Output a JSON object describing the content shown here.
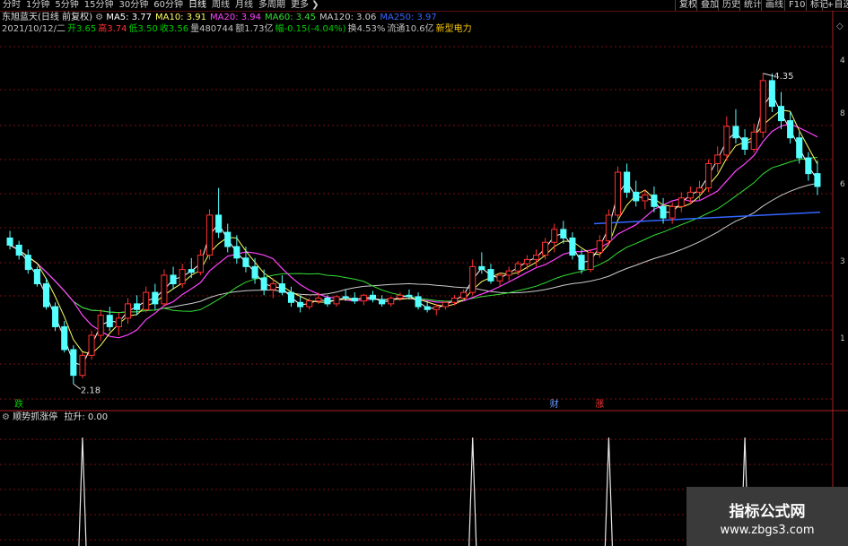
{
  "toolbar": {
    "period_tabs": [
      "分时",
      "1分钟",
      "5分钟",
      "15分钟",
      "30分钟",
      "60分钟",
      "日线",
      "周线",
      "月线",
      "多周期",
      "更多"
    ],
    "right_buttons": [
      "复权",
      "叠加",
      "历史",
      "统计",
      "画线",
      "F10",
      "标记",
      "+自选"
    ]
  },
  "header": {
    "stock_title": "东旭蓝天(日线 前复权)",
    "ma_items": [
      {
        "label": "MA5: 3.77",
        "color": "#ffffff"
      },
      {
        "label": "MA10: 3.91",
        "color": "#ffff66"
      },
      {
        "label": "MA20: 3.94",
        "color": "#ff44ff"
      },
      {
        "label": "MA60: 3.45",
        "color": "#33dd33"
      },
      {
        "label": "MA120: 3.06",
        "color": "#cccccc"
      },
      {
        "label": "MA250: 3.97",
        "color": "#3366ff"
      }
    ],
    "info_items": [
      {
        "label": "2021/10/12/二",
        "color": "#c0c0c0"
      },
      {
        "label": "开3.65",
        "color": "#00cc00"
      },
      {
        "label": "高3.74",
        "color": "#ff3333"
      },
      {
        "label": "低3.50",
        "color": "#00cc00"
      },
      {
        "label": "收3.56",
        "color": "#00cc00"
      },
      {
        "label": "量480744",
        "color": "#c0c0c0"
      },
      {
        "label": "额1.73亿",
        "color": "#c0c0c0"
      },
      {
        "label": "幅-0.15(-4.04%)",
        "color": "#00cc00"
      },
      {
        "label": "换4.53%",
        "color": "#c0c0c0"
      },
      {
        "label": "流通10.6亿",
        "color": "#c0c0c0"
      },
      {
        "label": "新型电力",
        "color": "#ffcc00"
      }
    ]
  },
  "annotations": {
    "high_label": "4.35",
    "low_label": "2.18",
    "bottom_marks": [
      {
        "text": "跌",
        "color": "#00cc00",
        "index": 1
      },
      {
        "text": "财",
        "color": "#6699ff",
        "index": 86
      },
      {
        "text": "涨",
        "color": "#ff3333",
        "index": 94
      }
    ],
    "right_axis_glyphs": [
      "4",
      "8",
      "6",
      "3",
      "1"
    ]
  },
  "indicator": {
    "title": "顺势抓涨停",
    "value_label": "拉升: 0.00",
    "spike_indices": [
      18,
      120,
      155,
      190
    ]
  },
  "watermark": {
    "line1": "指标公式网",
    "line2": "www.zbgs3.com"
  },
  "chart_data": {
    "type": "candlestick",
    "ylim": [
      2.0,
      4.6
    ],
    "colors": {
      "up": "#ff3232",
      "down": "#54ffff",
      "ma5": "#ffffff",
      "ma10": "#ffff66",
      "ma20": "#ff44ff",
      "ma60": "#33dd33",
      "ma120": "#cccccc",
      "ma250": "#3366ff"
    },
    "ohlc": [
      [
        3.2,
        3.25,
        3.12,
        3.15
      ],
      [
        3.15,
        3.18,
        3.05,
        3.08
      ],
      [
        3.08,
        3.12,
        2.95,
        2.98
      ],
      [
        2.98,
        3.0,
        2.86,
        2.88
      ],
      [
        2.88,
        2.92,
        2.7,
        2.72
      ],
      [
        2.72,
        2.75,
        2.55,
        2.58
      ],
      [
        2.58,
        2.62,
        2.4,
        2.42
      ],
      [
        2.42,
        2.45,
        2.18,
        2.24
      ],
      [
        2.24,
        2.4,
        2.22,
        2.38
      ],
      [
        2.38,
        2.55,
        2.35,
        2.52
      ],
      [
        2.52,
        2.7,
        2.48,
        2.66
      ],
      [
        2.66,
        2.72,
        2.55,
        2.58
      ],
      [
        2.58,
        2.68,
        2.52,
        2.64
      ],
      [
        2.64,
        2.78,
        2.6,
        2.74
      ],
      [
        2.74,
        2.8,
        2.66,
        2.7
      ],
      [
        2.7,
        2.86,
        2.68,
        2.82
      ],
      [
        2.82,
        2.88,
        2.7,
        2.74
      ],
      [
        2.74,
        2.98,
        2.72,
        2.94
      ],
      [
        2.94,
        3.0,
        2.84,
        2.88
      ],
      [
        2.88,
        3.02,
        2.85,
        2.98
      ],
      [
        2.98,
        3.06,
        2.92,
        2.96
      ],
      [
        2.96,
        3.12,
        2.94,
        3.08
      ],
      [
        3.08,
        3.4,
        3.05,
        3.36
      ],
      [
        3.36,
        3.55,
        3.2,
        3.24
      ],
      [
        3.24,
        3.3,
        3.1,
        3.14
      ],
      [
        3.14,
        3.22,
        3.02,
        3.06
      ],
      [
        3.06,
        3.14,
        2.96,
        3.0
      ],
      [
        3.0,
        3.06,
        2.88,
        2.92
      ],
      [
        2.92,
        2.98,
        2.8,
        2.84
      ],
      [
        2.84,
        2.92,
        2.78,
        2.88
      ],
      [
        2.88,
        2.94,
        2.8,
        2.82
      ],
      [
        2.82,
        2.86,
        2.72,
        2.75
      ],
      [
        2.75,
        2.8,
        2.68,
        2.72
      ],
      [
        2.72,
        2.78,
        2.7,
        2.76
      ],
      [
        2.76,
        2.82,
        2.74,
        2.78
      ],
      [
        2.78,
        2.8,
        2.72,
        2.74
      ],
      [
        2.74,
        2.8,
        2.72,
        2.79
      ],
      [
        2.79,
        2.84,
        2.76,
        2.78
      ],
      [
        2.78,
        2.82,
        2.74,
        2.76
      ],
      [
        2.76,
        2.81,
        2.73,
        2.8
      ],
      [
        2.8,
        2.83,
        2.75,
        2.77
      ],
      [
        2.77,
        2.8,
        2.72,
        2.74
      ],
      [
        2.74,
        2.79,
        2.72,
        2.78
      ],
      [
        2.78,
        2.82,
        2.76,
        2.8
      ],
      [
        2.8,
        2.84,
        2.77,
        2.79
      ],
      [
        2.79,
        2.82,
        2.7,
        2.72
      ],
      [
        2.72,
        2.76,
        2.68,
        2.7
      ],
      [
        2.7,
        2.74,
        2.66,
        2.72
      ],
      [
        2.72,
        2.76,
        2.7,
        2.75
      ],
      [
        2.75,
        2.8,
        2.73,
        2.78
      ],
      [
        2.78,
        2.84,
        2.76,
        2.82
      ],
      [
        2.82,
        3.05,
        2.8,
        3.0
      ],
      [
        3.0,
        3.1,
        2.95,
        2.98
      ],
      [
        2.98,
        3.02,
        2.88,
        2.9
      ],
      [
        2.9,
        2.96,
        2.86,
        2.94
      ],
      [
        2.94,
        3.0,
        2.9,
        2.97
      ],
      [
        2.97,
        3.04,
        2.94,
        3.02
      ],
      [
        3.02,
        3.08,
        2.98,
        3.05
      ],
      [
        3.05,
        3.12,
        3.0,
        3.08
      ],
      [
        3.08,
        3.2,
        3.05,
        3.17
      ],
      [
        3.17,
        3.3,
        3.1,
        3.26
      ],
      [
        3.26,
        3.32,
        3.16,
        3.2
      ],
      [
        3.2,
        3.24,
        3.05,
        3.08
      ],
      [
        3.08,
        3.12,
        2.95,
        2.98
      ],
      [
        2.98,
        3.12,
        2.96,
        3.1
      ],
      [
        3.1,
        3.22,
        3.06,
        3.18
      ],
      [
        3.18,
        3.4,
        3.15,
        3.36
      ],
      [
        3.36,
        3.7,
        3.34,
        3.66
      ],
      [
        3.66,
        3.72,
        3.48,
        3.52
      ],
      [
        3.52,
        3.6,
        3.42,
        3.46
      ],
      [
        3.46,
        3.54,
        3.4,
        3.5
      ],
      [
        3.5,
        3.56,
        3.38,
        3.42
      ],
      [
        3.42,
        3.48,
        3.3,
        3.34
      ],
      [
        3.34,
        3.45,
        3.3,
        3.42
      ],
      [
        3.42,
        3.52,
        3.38,
        3.48
      ],
      [
        3.48,
        3.56,
        3.44,
        3.52
      ],
      [
        3.52,
        3.6,
        3.46,
        3.55
      ],
      [
        3.55,
        3.75,
        3.52,
        3.72
      ],
      [
        3.72,
        3.84,
        3.66,
        3.78
      ],
      [
        3.78,
        4.05,
        3.74,
        3.98
      ],
      [
        3.98,
        4.1,
        3.86,
        3.9
      ],
      [
        3.9,
        3.96,
        3.78,
        3.82
      ],
      [
        3.82,
        4.0,
        3.8,
        3.94
      ],
      [
        3.94,
        4.35,
        3.9,
        4.3
      ],
      [
        4.3,
        4.35,
        4.08,
        4.12
      ],
      [
        4.12,
        4.22,
        3.96,
        4.02
      ],
      [
        4.02,
        4.08,
        3.86,
        3.9
      ],
      [
        3.9,
        3.94,
        3.72,
        3.76
      ],
      [
        3.76,
        3.8,
        3.6,
        3.65
      ],
      [
        3.65,
        3.74,
        3.5,
        3.56
      ]
    ],
    "ma250": [
      [
        93,
        3.3
      ],
      [
        129,
        3.38
      ]
    ]
  }
}
